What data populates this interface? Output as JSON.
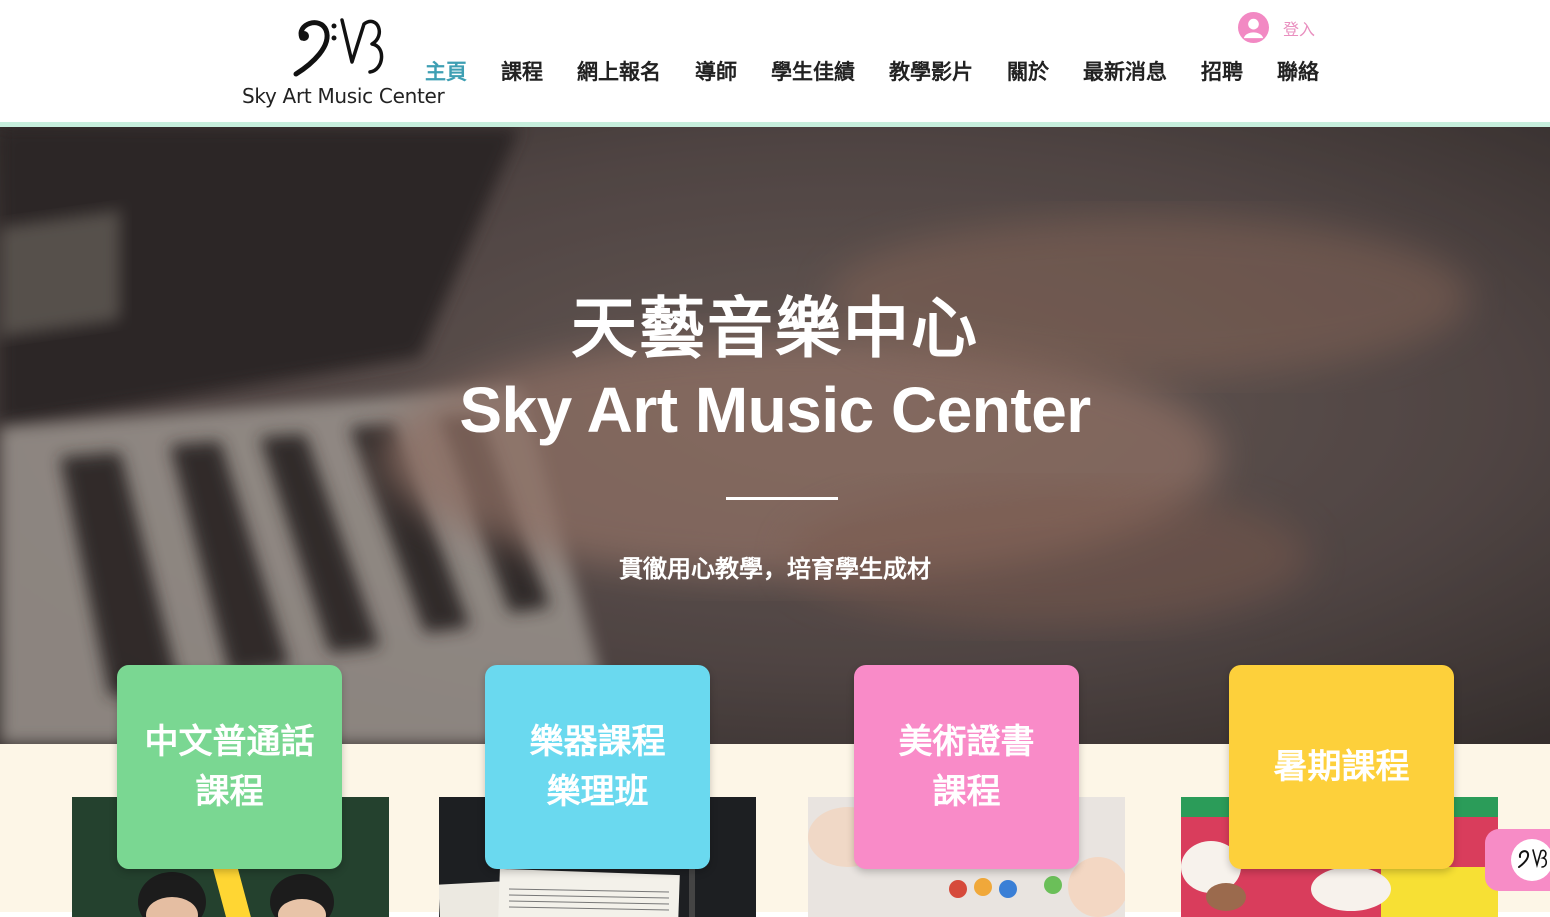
{
  "header": {
    "logo_text": "Sky Art Music Center",
    "nav": [
      {
        "label": "主頁",
        "active": true
      },
      {
        "label": "課程"
      },
      {
        "label": "網上報名"
      },
      {
        "label": "導師"
      },
      {
        "label": "學生佳績"
      },
      {
        "label": "教學影片"
      },
      {
        "label": "關於"
      },
      {
        "label": "最新消息"
      },
      {
        "label": "招聘"
      },
      {
        "label": "聯絡"
      }
    ],
    "login_label": "登入",
    "active_color": "#3e9fb3",
    "accent_line_color": "#c6eedc"
  },
  "hero": {
    "title_zh": "天藝音樂中心",
    "title_en": "Sky Art Music Center",
    "tagline": "貫徹用心教學，培育學生成材"
  },
  "courses": [
    {
      "line1": "中文普通話",
      "line2": "課程",
      "color": "#7ad792",
      "icon": "classroom-photo"
    },
    {
      "line1": "樂器課程",
      "line2": "樂理班",
      "color": "#6ad9ef",
      "icon": "sheet-music-photo"
    },
    {
      "line1": "美術證書",
      "line2": "課程",
      "color": "#f98bc8",
      "icon": "painting-photo"
    },
    {
      "line1": "暑期課程",
      "line2": "",
      "color": "#fdd03b",
      "icon": "crafts-photo"
    }
  ]
}
